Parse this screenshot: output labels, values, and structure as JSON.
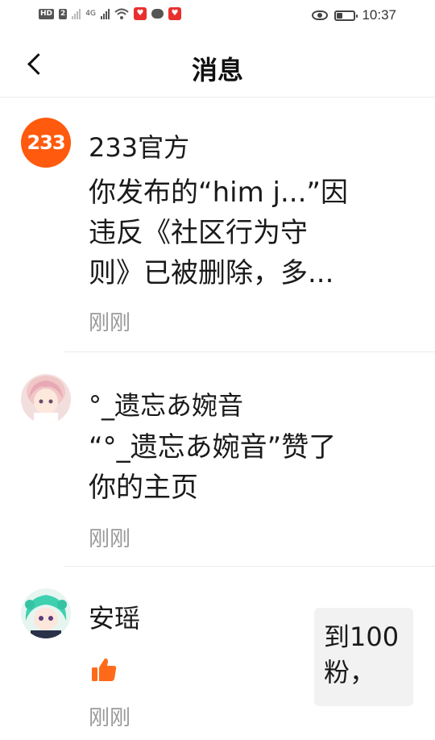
{
  "status_bar": {
    "hd_badge": "HD",
    "sim_badge": "2",
    "network": "4G",
    "time": "10:37",
    "battery_level": 0.3
  },
  "header": {
    "title": "消息"
  },
  "messages": [
    {
      "sender": "233官方",
      "avatar_text": "233",
      "content_lines": [
        "你发布的“him j...”因",
        "违反《社区行为守",
        "则》已被删除，多..."
      ],
      "time": "刚刚"
    },
    {
      "sender": "°_遗忘あ婉音",
      "content_lines": [
        "“°_遗忘あ婉音”赞了",
        "你的主页"
      ],
      "time": "刚刚"
    },
    {
      "sender": "安瑶",
      "time": "刚刚",
      "preview_lines": [
        "到100",
        "粉，"
      ]
    }
  ],
  "colors": {
    "brand_orange": "#ff5a0e",
    "like_orange": "#ff6a1a"
  }
}
